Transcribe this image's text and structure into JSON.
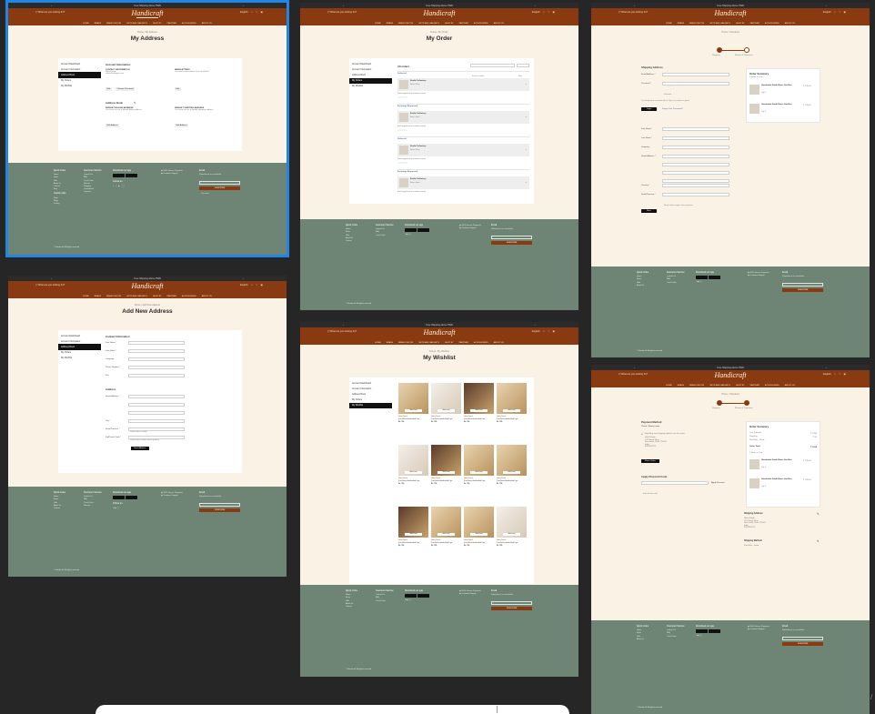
{
  "common": {
    "announcement": "Free Shipping above ₹999",
    "announce_prev": "‹",
    "announce_next": "›",
    "brand": "Handicraft",
    "search_placeholder": "What are you looking for?",
    "language": "English",
    "nav": [
      "HOME",
      "BRASS",
      "BRASS DECOR",
      "GIFTS AND GADGETS",
      "SHOP BY",
      "PARTNER",
      "ACCESSORIES",
      "ABOUT US"
    ],
    "footer": {
      "col1_title": "Quick Links",
      "col1": [
        "Home",
        "Brass",
        "Gifts",
        "About Us",
        "Contact",
        "Blog"
      ],
      "col1b_title": "Useful Links",
      "col1b": [
        "Shop",
        "Blogs",
        "Privacy",
        "Terms"
      ],
      "col2_title": "Customer Service",
      "col2": [
        "Contact Us",
        "FAQ",
        "Track Order",
        "Returns",
        "Shipping",
        "Cancellation",
        "Payment"
      ],
      "col3_title": "Download our app",
      "store1": "Google Play",
      "store2": "App Store",
      "follow": "Follow us",
      "col4_a": "100% Secure Payments",
      "col4_b": "Customer Support",
      "col5_title": "Email",
      "subscribe_text": "Subscribe to our newsletter",
      "email_placeholder": "Your email",
      "subscribe_btn": "SUBSCRIBE",
      "copyright": "© Handicraft. All rights reserved"
    }
  },
  "my_address": {
    "crumb": "Home / My Address",
    "title": "My Address",
    "sidebar": [
      "Account Dashboard",
      "Account Information",
      "Address Book",
      "My Orders",
      "My Wishlist"
    ],
    "active": 2,
    "account_info": "Account Information",
    "contact_h": "CONTACT INFORMATION",
    "contact_name": "Nikhil Singh",
    "contact_email": "nikhil@example.com",
    "edit": "Edit",
    "change_password": "Change Password",
    "newsletters_h": "NEWSLETTERS",
    "newsletters_text": "You aren't subscribed to our newsletter.",
    "address_book": "Address Book",
    "billing_h": "DEFAULT BILLING ADDRESS",
    "billing_text": "You have not set a default billing address.",
    "shipping_h": "DEFAULT SHIPPING ADDRESS",
    "shipping_text": "You have not set a default shipping address.",
    "edit_address": "Edit Address"
  },
  "add_address": {
    "crumb": "Home / Add New Address",
    "title": "Add New Address",
    "sidebar": [
      "Account Dashboard",
      "Account Information",
      "Address Book",
      "My Orders",
      "My Wishlist"
    ],
    "active": 2,
    "contact_h": "Contact Information",
    "fields": [
      "First Name *",
      "Last Name *",
      "Company",
      "Phone Number *",
      "Fax"
    ],
    "address_h": "Address",
    "address_fields": [
      "Street Address *",
      "",
      "",
      "City *",
      "State/Province *",
      "Zip/Postal Code *"
    ],
    "country_label": "Country *",
    "country_value": "Please select a country",
    "state_value": "Please select a region, state or province",
    "save": "Save Address"
  },
  "my_order": {
    "crumb": "Home / My Order",
    "title": "My Order",
    "sidebar": [
      "Account Dashboard",
      "Account Information",
      "Address Book",
      "My Orders",
      "My Wishlist"
    ],
    "active": 3,
    "all_orders": "All orders",
    "search_placeholder": "Search in orders",
    "filter": "Filter",
    "orders": [
      {
        "status": "Delivered",
        "name": "Kuchi Collectory",
        "meta": "Brass Item",
        "note": "Exchange/return window closed"
      },
      {
        "status": "Exchange Requested",
        "name": "Kuchi Collectory",
        "meta": "Brass Item",
        "note": "Exchange/return window closed"
      },
      {
        "status": "Delivered",
        "name": "Kuchi Collectory",
        "meta": "Brass Item",
        "note": "Exchange/return window closed"
      },
      {
        "status": "Exchange Requested",
        "name": "Kuchi Collectory",
        "meta": "Brass Item",
        "note": "Exchange/return window closed"
      }
    ]
  },
  "my_wishlist": {
    "crumb": "Home / My Wishlist",
    "title": "My Wishlist",
    "sidebar": [
      "Account Dashboard",
      "Account Information",
      "Address Book",
      "My Orders",
      "My Wishlist"
    ],
    "active": 4,
    "add_to_bag": "Add to bag",
    "products": [
      {
        "cat": "Home Decor",
        "name": "Pure Brass Handcrafted Diya",
        "price": "Rs. 799"
      },
      {
        "cat": "Home Decor",
        "name": "Pure Brass Handcrafted Diya",
        "price": "Rs. 799"
      },
      {
        "cat": "Home Decor",
        "name": "Pure Brass Handcrafted Diya",
        "price": "Rs. 799"
      },
      {
        "cat": "Home Decor",
        "name": "Pure Brass Handcrafted Diya",
        "price": "Rs. 799"
      },
      {
        "cat": "Home Decor",
        "name": "Pure Brass Handcrafted Diya",
        "price": "Rs. 799"
      },
      {
        "cat": "Home Decor",
        "name": "Pure Brass Handcrafted Diya",
        "price": "Rs. 799"
      },
      {
        "cat": "Home Decor",
        "name": "Pure Brass Handcrafted Diya",
        "price": "Rs. 799"
      },
      {
        "cat": "Home Decor",
        "name": "Pure Brass Handcrafted Diya",
        "price": "Rs. 799"
      },
      {
        "cat": "Home Decor",
        "name": "Pure Brass Handcrafted Diya",
        "price": "Rs. 799"
      },
      {
        "cat": "Home Decor",
        "name": "Pure Brass Handcrafted Diya",
        "price": "Rs. 799"
      },
      {
        "cat": "Home Decor",
        "name": "Pure Brass Handcrafted Diya",
        "price": "Rs. 799"
      },
      {
        "cat": "Home Decor",
        "name": "Pure Brass Handcrafted Diya",
        "price": "Rs. 799"
      }
    ]
  },
  "shipping": {
    "crumb": "Home / Checkout",
    "step1": "Shipping",
    "step2": "Review & Payments",
    "shipping_h": "Shipping Address",
    "email_label": "Email Address *",
    "email_value": "nikhil_singh@example.com",
    "password_label": "Password *",
    "password_value": "Password",
    "login_hint": "You already have an account with us. Sign in or continue as guest.",
    "login": "Login",
    "forgot": "Forgot Your Password?",
    "fields": [
      "First Name *",
      "Last Name *",
      "Company",
      "Street Address *",
      "",
      "",
      "City *",
      "Zip/Postal Code *",
      "Country *",
      "State/Province *",
      "Phone Number *"
    ],
    "state_value": "Please select a region, state or province",
    "next": "Next",
    "summary_h": "Order Summary",
    "items_count": "2 Items in Cart",
    "item_name": "Handmade Dabbi Brass Hot Box",
    "item_qty": "Qty 1",
    "item_price": "₹ 799.00",
    "view_details": "View Details"
  },
  "payment": {
    "crumb": "Home / Checkout",
    "step1": "Shipping",
    "step2": "Review & Payments",
    "method_h": "Payment Method",
    "method": "Check / Money order",
    "same_address": "My billing and shipping address are the same",
    "addr_lines": [
      "Nikhil Singh",
      "123 Street, Area",
      "New Delhi, Delhi 110001",
      "India",
      "9876543210"
    ],
    "place_order": "Place Order",
    "discount_h": "Apply Discount Code",
    "discount_placeholder": "Enter discount code",
    "apply": "Apply Discount",
    "summary_h": "Order Summary",
    "cart_subtotal_label": "Cart Subtotal",
    "cart_subtotal": "₹ 1598",
    "shipping_label": "Shipping",
    "shipping_value": "₹ 20",
    "shipping_method_note": "Flat Rate - Fixed",
    "total_label": "Order Total",
    "total": "₹ 1618",
    "items_count": "2 Items in Cart",
    "item_name": "Handmade Dabbi Brass Hot Box",
    "item_qty": "Qty 1",
    "item_price": "₹ 799.00",
    "ship_to_h": "Shipping Address:",
    "ship_to": [
      "Nikhil Singh",
      "123 Street, Area",
      "New Delhi, Delhi 110001",
      "India",
      "9876543210"
    ],
    "ship_method_h": "Shipping Method:",
    "ship_method": "Flat Rate - Fixed"
  }
}
